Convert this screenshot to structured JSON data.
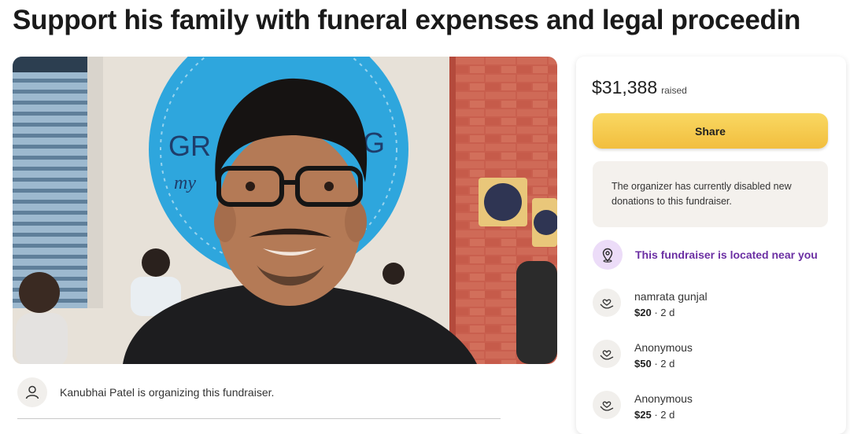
{
  "page": {
    "title": "Support his family with funeral expenses and legal proceedin"
  },
  "hero": {
    "sign_text_1": "GR",
    "sign_text_2": "G",
    "sign_text_3": "my"
  },
  "organizer": {
    "text": "Kanubhai Patel is organizing this fundraiser."
  },
  "panel": {
    "raised_amount": "$31,388",
    "raised_label": "raised",
    "share_label": "Share",
    "notice": "The organizer has currently disabled new donations to this fundraiser.",
    "location_text": "This fundraiser is located near you",
    "donations": [
      {
        "name": "namrata gunjal",
        "amount": "$20",
        "sep": " · ",
        "time": "2 d"
      },
      {
        "name": "Anonymous",
        "amount": "$50",
        "sep": " · ",
        "time": "2 d"
      },
      {
        "name": "Anonymous",
        "amount": "$25",
        "sep": " · ",
        "time": "2 d"
      }
    ]
  },
  "colors": {
    "share_button": "#f6c94f",
    "location_accent": "#6b2fa3",
    "notice_bg": "#f4f1ed"
  }
}
